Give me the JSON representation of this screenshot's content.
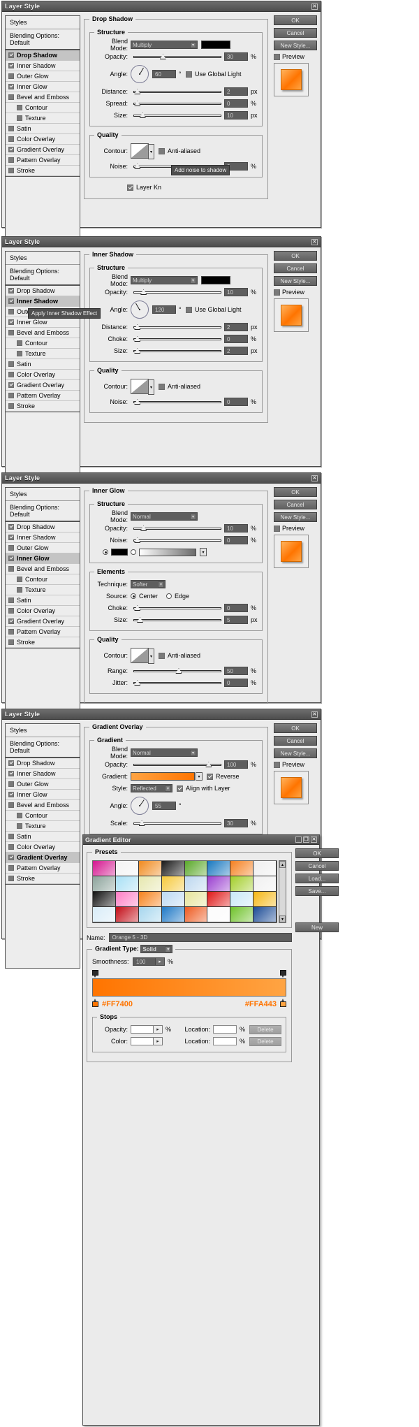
{
  "window_title": "Layer Style",
  "titlebar_buttons": {
    "close": "✕",
    "minimize": "_",
    "maximize": "❐"
  },
  "styles_panel": {
    "header": "Styles",
    "blending_options": "Blending Options: Default",
    "items": [
      {
        "label": "Drop Shadow",
        "checked": true
      },
      {
        "label": "Inner Shadow",
        "checked": true
      },
      {
        "label": "Outer Glow",
        "checked": false
      },
      {
        "label": "Inner Glow",
        "checked": true
      },
      {
        "label": "Bevel and Emboss",
        "checked": false
      },
      {
        "label": "Contour",
        "checked": false,
        "indent": true
      },
      {
        "label": "Texture",
        "checked": false,
        "indent": true
      },
      {
        "label": "Satin",
        "checked": false
      },
      {
        "label": "Color Overlay",
        "checked": false
      },
      {
        "label": "Gradient Overlay",
        "checked": true
      },
      {
        "label": "Pattern Overlay",
        "checked": false
      },
      {
        "label": "Stroke",
        "checked": false
      }
    ]
  },
  "buttons": {
    "ok": "OK",
    "cancel": "Cancel",
    "new_style": "New Style...",
    "preview": "Preview",
    "load": "Load...",
    "save": "Save...",
    "new": "New",
    "delete": "Delete"
  },
  "labels": {
    "blend_mode": "Blend Mode:",
    "opacity": "Opacity:",
    "angle": "Angle:",
    "distance": "Distance:",
    "spread": "Spread:",
    "size": "Size:",
    "choke": "Choke:",
    "noise": "Noise:",
    "contour": "Contour:",
    "technique": "Technique:",
    "source": "Source:",
    "range": "Range:",
    "jitter": "Jitter:",
    "gradient": "Gradient:",
    "style": "Style:",
    "scale": "Scale:",
    "name": "Name:",
    "gradient_type": "Gradient Type:",
    "smoothness": "Smoothness:",
    "color": "Color:",
    "location": "Location:",
    "use_global_light": "Use Global Light",
    "anti_aliased": "Anti-aliased",
    "layer_knocks_out": "Layer Kn",
    "reverse": "Reverse",
    "align_with_layer": "Align with Layer",
    "center": "Center",
    "edge": "Edge",
    "pct": "%",
    "px": "px",
    "deg": "°"
  },
  "panels": [
    {
      "id": "drop-shadow",
      "section_title": "Drop Shadow",
      "structure_title": "Structure",
      "quality_title": "Quality",
      "blend_mode": "Multiply",
      "opacity": "30",
      "angle": "60",
      "angle_deg": 60,
      "distance": "2",
      "spread": "0",
      "size": "10",
      "noise": "0",
      "tooltip": "Add noise to shadow"
    },
    {
      "id": "inner-shadow",
      "section_title": "Inner Shadow",
      "structure_title": "Structure",
      "quality_title": "Quality",
      "blend_mode": "Multiply",
      "opacity": "10",
      "angle": "120",
      "angle_deg": 120,
      "distance": "2",
      "choke": "0",
      "size": "2",
      "noise": "0",
      "tooltip": "Apply Inner Shadow Effect"
    },
    {
      "id": "inner-glow",
      "section_title": "Inner Glow",
      "structure_title": "Structure",
      "elements_title": "Elements",
      "quality_title": "Quality",
      "blend_mode": "Normal",
      "opacity": "10",
      "noise": "0",
      "technique": "Softer",
      "choke": "0",
      "size": "5",
      "range": "50",
      "jitter": "0"
    },
    {
      "id": "gradient-overlay",
      "section_title": "Gradient Overlay",
      "gradient_title": "Gradient",
      "blend_mode": "Normal",
      "opacity": "100",
      "style": "Reflected",
      "angle": "55",
      "angle_deg": 55,
      "scale": "30"
    }
  ],
  "gradient_editor": {
    "title": "Gradient Editor",
    "presets_title": "Presets",
    "stops_title": "Stops",
    "name_value": "Orange 5 - 3D",
    "gradient_type_value": "Solid",
    "smoothness_value": "100",
    "left_stop_hex": "#FF7400",
    "right_stop_hex": "#FFA443",
    "opacity_label": "Opacity:",
    "color_label": "Color:",
    "location_label": "Location:",
    "opacity_value": "",
    "location_value_1": "",
    "color_value": "",
    "location_value_2": "",
    "preset_colors": [
      [
        "#d4168f",
        "#f3f3f3",
        "#f08a1e",
        "#1a1a1a",
        "#5aa82a",
        "#1878c0",
        "#f58020",
        "#efefef"
      ],
      [
        "#8ca39b",
        "#a9e0f5",
        "#e6e7ae",
        "#f6c93c",
        "#bcd7ef",
        "#9a3fd0",
        "#a3ce2a",
        "#f0f0f0"
      ],
      [
        "#111111",
        "#ff7ec4",
        "#f7821b",
        "#bcd8f2",
        "#e6e49a",
        "#e01717",
        "#c9e8f7",
        "#f6b713"
      ],
      [
        "#d8ecf8",
        "#c30d17",
        "#a6d6ee",
        "#1f79c6",
        "#ee5a20",
        "#fbfbfb",
        "#6fc22a",
        "#1b4b96"
      ]
    ]
  },
  "accent_colors": {
    "orange_dark": "#FF7400",
    "orange_light": "#FFA443",
    "titlebar": "#5a5a5a"
  }
}
